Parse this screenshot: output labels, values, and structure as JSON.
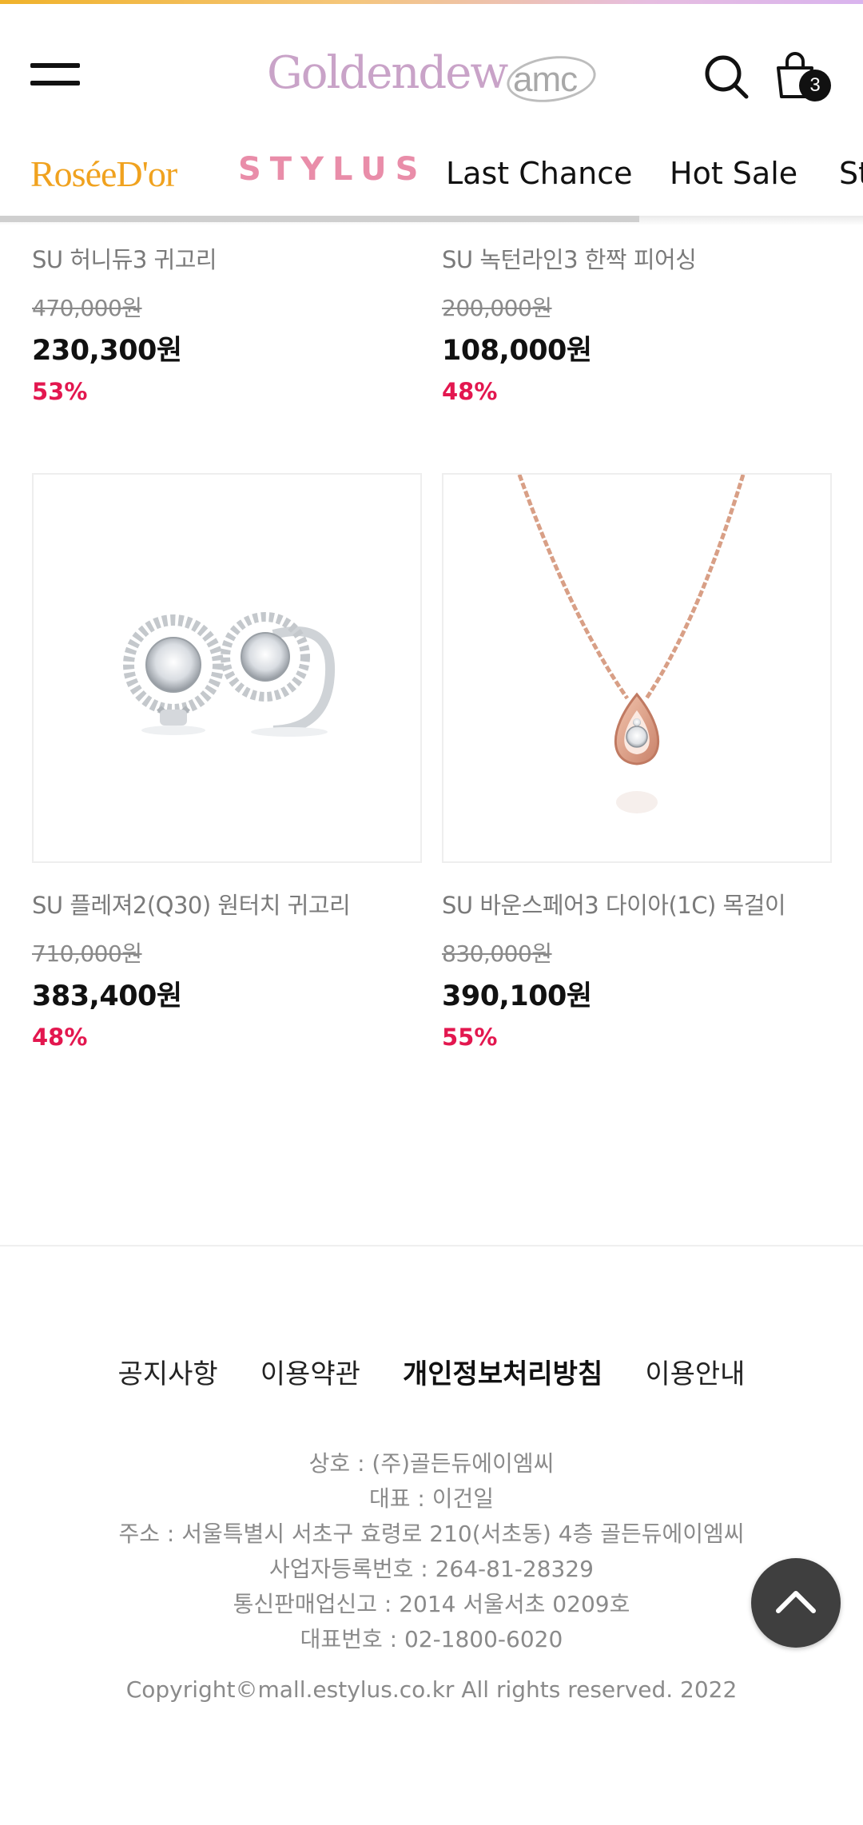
{
  "header": {
    "logo_text": "Goldendew",
    "logo_sub": "amc",
    "cart_count": "3"
  },
  "categories": {
    "rosee": "RoséeD'or",
    "stylus": "STYLUS",
    "last_chance": "Last Chance",
    "hot_sale": "Hot Sale",
    "more": "St"
  },
  "products": [
    {
      "name": "SU 허니듀3 귀고리",
      "original": "470,000원",
      "price": "230,300원",
      "discount": "53%"
    },
    {
      "name": "SU 녹턴라인3 한짝 피어싱",
      "original": "200,000원",
      "price": "108,000원",
      "discount": "48%"
    },
    {
      "name": "SU 플레져2(Q30) 원터치 귀고리",
      "original": "710,000원",
      "price": "383,400원",
      "discount": "48%"
    },
    {
      "name": "SU 바운스페어3 다이아(1C) 목걸이",
      "original": "830,000원",
      "price": "390,100원",
      "discount": "55%"
    }
  ],
  "footer": {
    "links": [
      "공지사항",
      "이용약관",
      "개인정보처리방침",
      "이용안내"
    ],
    "company": [
      "상호 : (주)골든듀에이엠씨",
      "대표 : 이건일",
      "주소 : 서울특별시 서초구 효령로 210(서초동) 4층 골든듀에이엠씨",
      "사업자등록번호 : 264-81-28329",
      "통신판매업신고 : 2014 서울서초 0209호",
      "대표번호 : 02-1800-6020"
    ],
    "copyright": "Copyright©mall.estylus.co.kr All rights reserved. 2022"
  },
  "colors": {
    "accent_discount": "#e3174f",
    "rosee": "#f0a21f",
    "stylus": "#e98da9",
    "logo": "#c9a3c8"
  }
}
